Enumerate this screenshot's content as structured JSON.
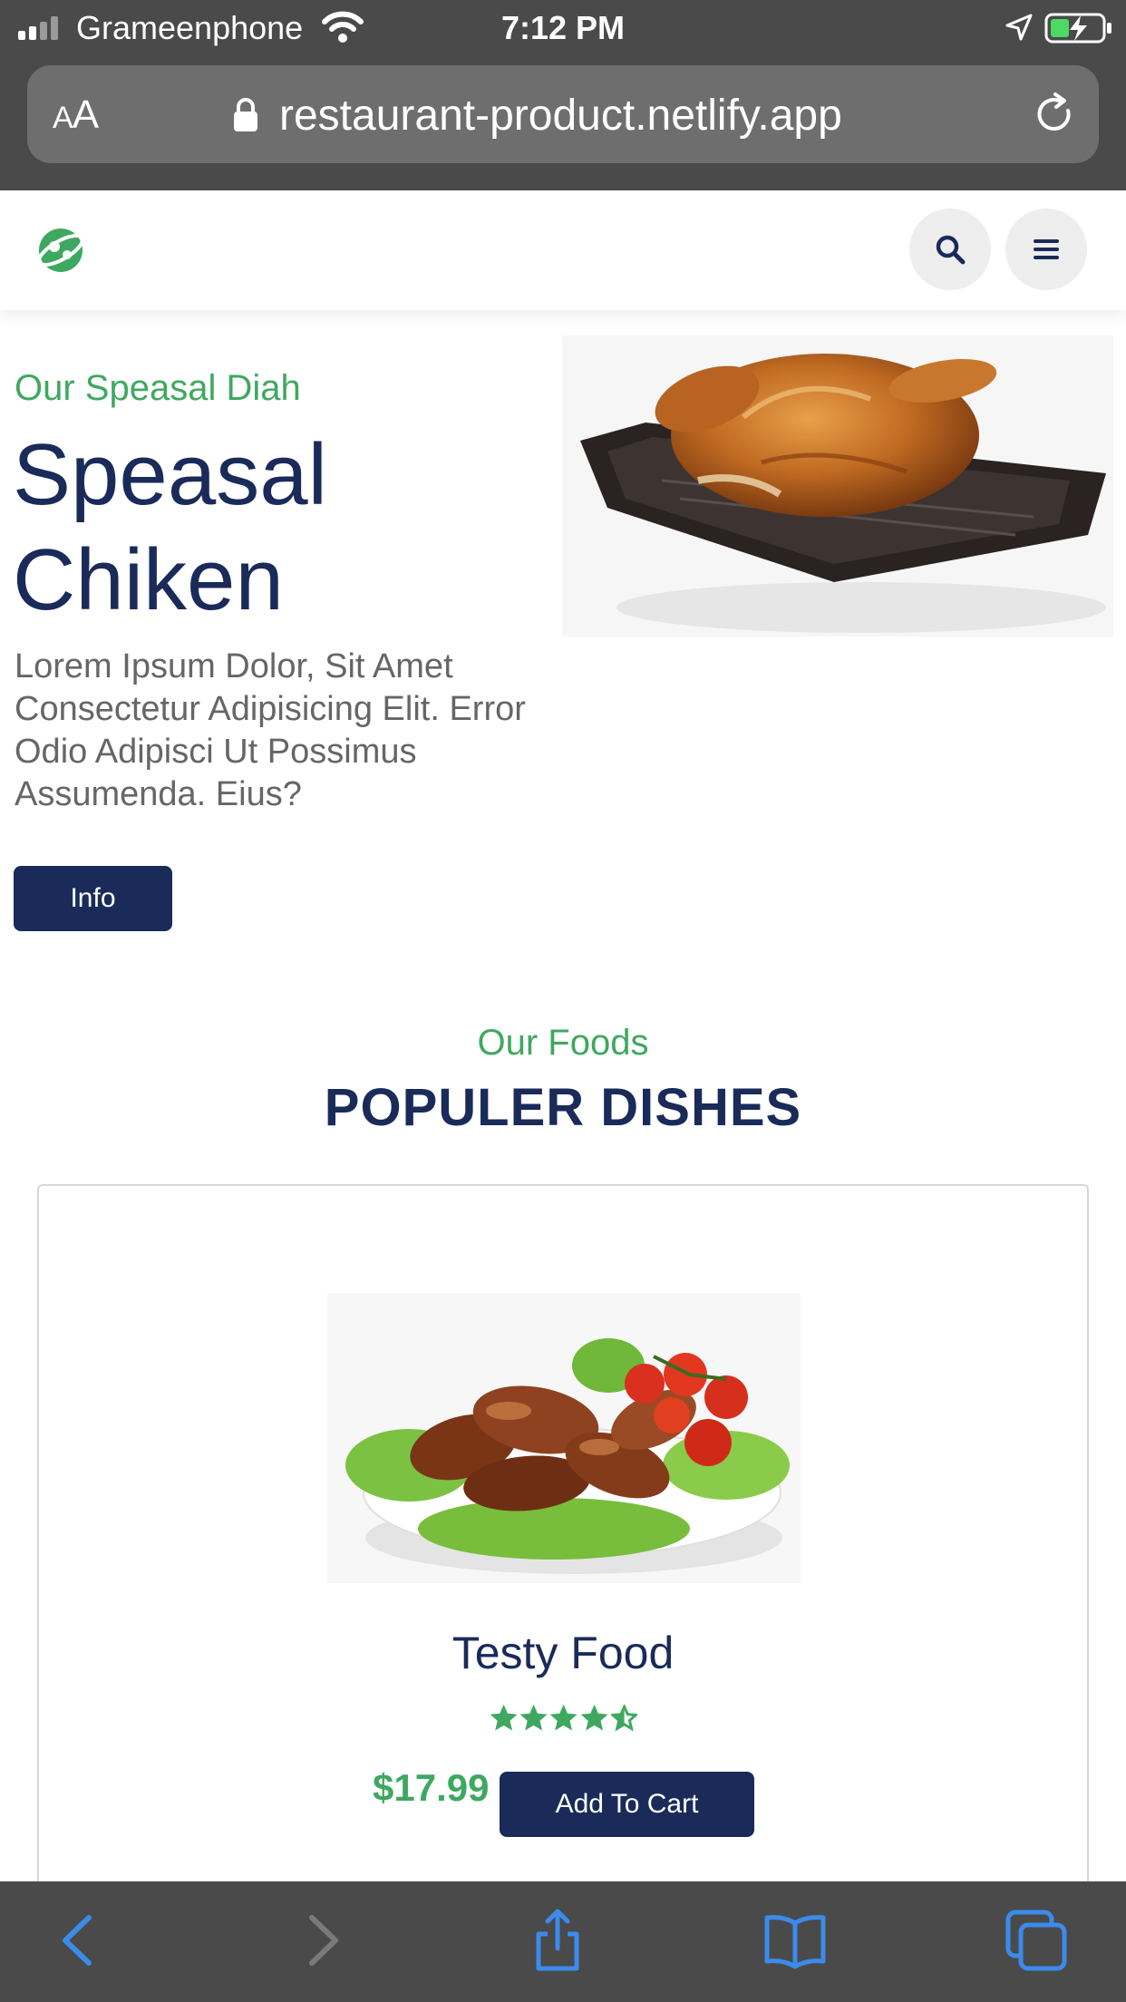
{
  "status_bar": {
    "carrier": "Grameenphone",
    "time": "7:12 PM",
    "signal_icon": "signal-bars-icon",
    "wifi_icon": "wifi-icon",
    "location_icon": "location-arrow-icon",
    "battery_icon": "battery-charging-icon"
  },
  "browser": {
    "aa_label_small": "A",
    "aa_label_large": "A",
    "url": "restaurant-product.netlify.app",
    "lock_icon": "lock-icon",
    "reload_icon": "reload-icon"
  },
  "header": {
    "logo_icon": "logo-icon",
    "search_icon": "search-icon",
    "menu_icon": "hamburger-menu-icon"
  },
  "hero": {
    "subtitle": "Our Speasal Diah",
    "title": "Speasal Chiken",
    "text": "Lorem Ipsum Dolor, Sit Amet Consectetur Adipisicing Elit. Error Odio Adipisci Ut Possimus Assumenda. Eius?",
    "button_label": "Info",
    "image": "roast-chicken-image"
  },
  "section": {
    "subtitle": "Our Foods",
    "title": "POPULER DISHES"
  },
  "product": {
    "image": "chicken-wings-salad-image",
    "name": "Testy Food",
    "rating": 4.5,
    "rating_max": 5,
    "price": "$17.99",
    "button_label": "Add To Cart"
  },
  "toolbar": {
    "back_icon": "back-arrow-icon",
    "forward_icon": "forward-arrow-icon",
    "share_icon": "share-icon",
    "bookmarks_icon": "bookmarks-book-icon",
    "tabs_icon": "tabs-icon"
  },
  "colors": {
    "accent_green": "#3fa860",
    "navy": "#1a2b5a",
    "chrome_gray": "#4a4a4a",
    "toolbar_blue": "#3b8beb"
  }
}
